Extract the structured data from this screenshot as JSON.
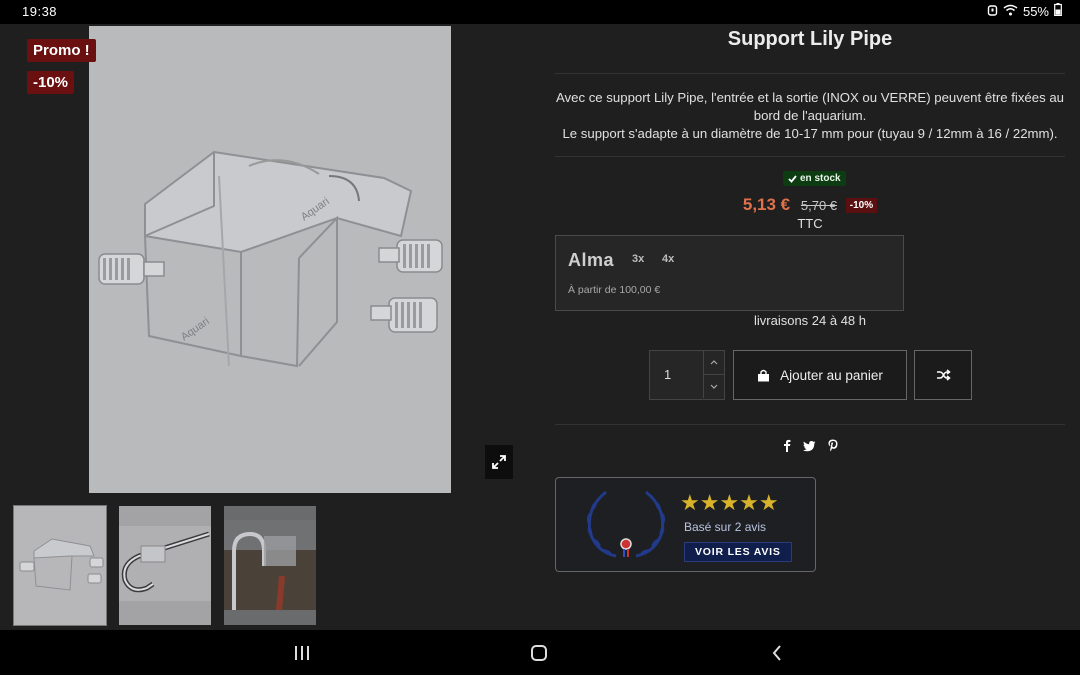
{
  "status_bar": {
    "time": "19:38",
    "battery": "55%",
    "icons": [
      "alarm-icon",
      "wifi-icon",
      "battery-icon"
    ]
  },
  "gallery": {
    "badges": {
      "promo": "Promo !",
      "discount": "-10%"
    },
    "main_image": "acrylic-pipe-holder-image",
    "expand_icon": "expand-icon",
    "thumbnails": [
      "pipe-holder-thumb",
      "steel-pipe-thumb",
      "installed-pipe-thumb"
    ]
  },
  "product": {
    "title": "Support Lily Pipe",
    "description": [
      "Avec ce support Lily Pipe, l'entrée et la sortie (INOX  ou VERRE)  peuvent être fixées au bord de l'aquarium.",
      "Le support s'adapte à un diamètre de 10-17 mm pour (tuyau 9 / 12mm à 16 / 22mm)."
    ],
    "stock": "en stock",
    "price_new": "5,13 €",
    "price_old": "5,70 €",
    "price_discount": "-10%",
    "tax_label": "TTC",
    "delivery": "livraisons 24 à 48 h"
  },
  "alma": {
    "logo": "Alma",
    "options": [
      "3x",
      "4x"
    ],
    "from_text": "À partir de 100,00 €"
  },
  "cart": {
    "quantity": "1",
    "add_label": "Ajouter au panier",
    "add_icon": "shopping-bag-icon",
    "compare_icon": "shuffle-icon"
  },
  "share": [
    "facebook-icon",
    "twitter-icon",
    "pinterest-icon"
  ],
  "reviews": {
    "stars": "★★★★★",
    "based_on": "Basé sur 2 avis",
    "see_label": "VOIR LES AVIS"
  },
  "colors": {
    "background": "#1f1f1f",
    "badge": "#6b1010",
    "price": "#e0714a",
    "stars": "#d7b22a",
    "stock": "#0d3b12"
  }
}
